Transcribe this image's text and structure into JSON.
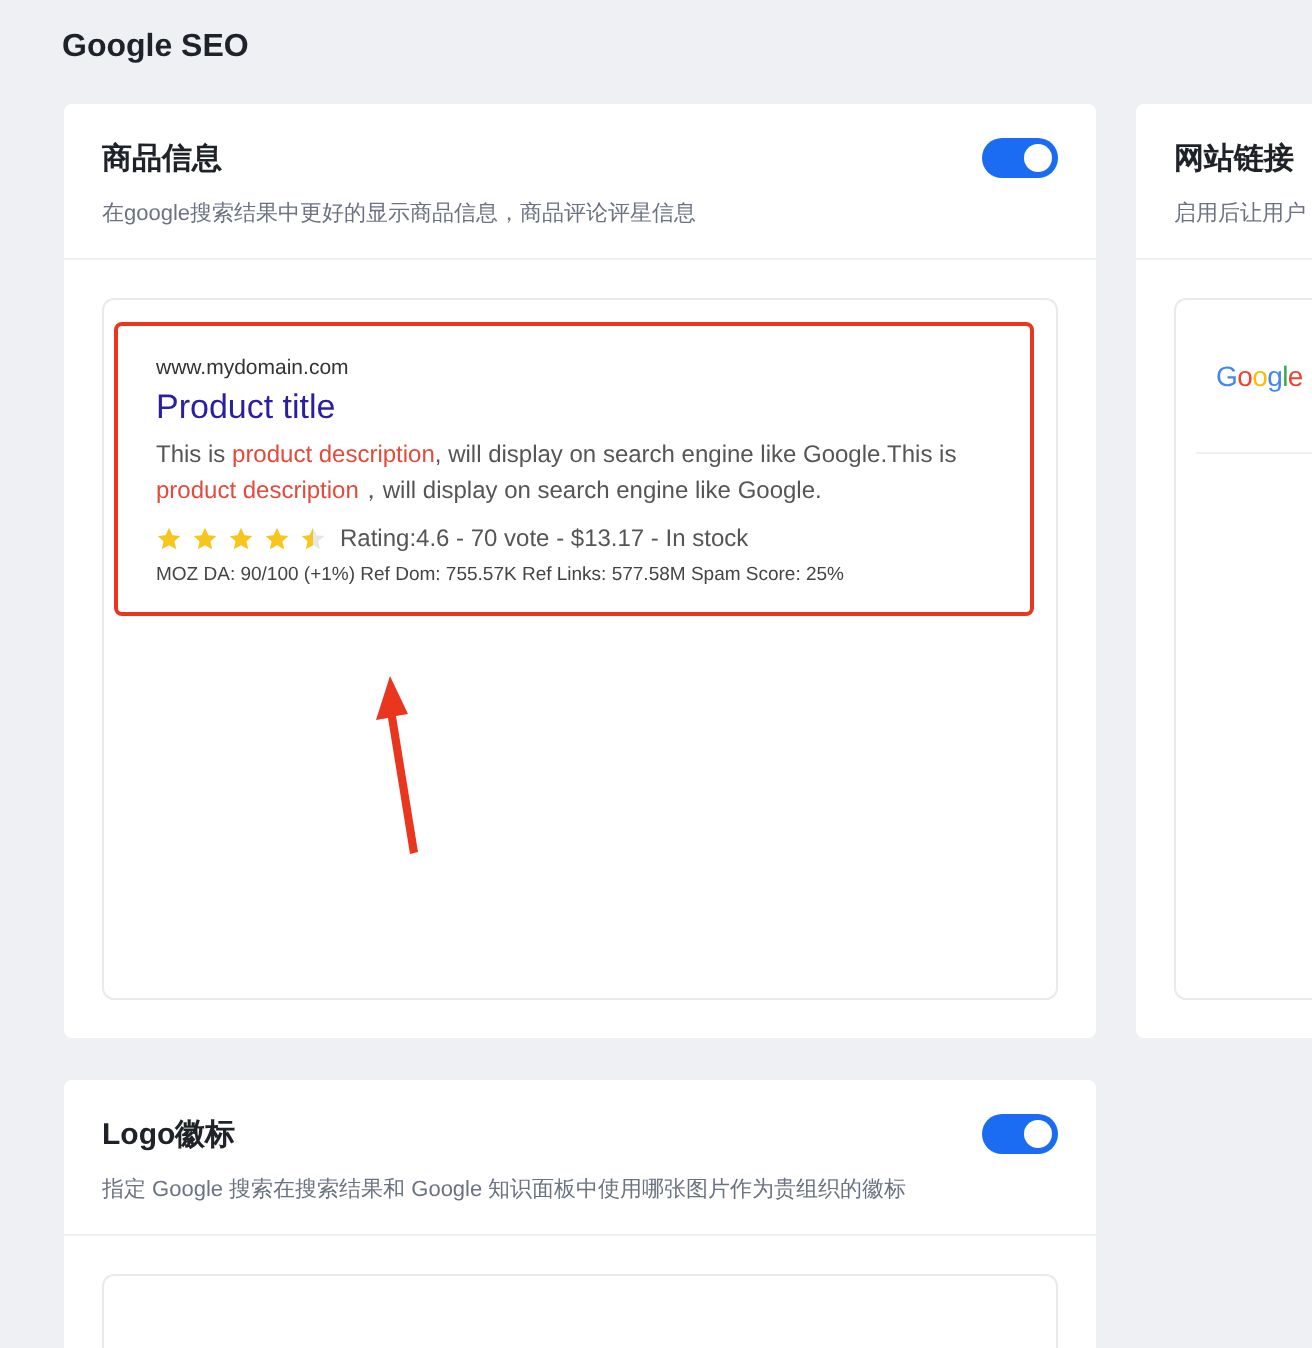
{
  "page_title": "Google SEO",
  "cards": [
    {
      "kind": "product_preview",
      "title": "商品信息",
      "description": "在google搜索结果中更好的显示商品信息，商品评论评星信息",
      "enabled": true,
      "preview": {
        "url": "www.mydomain.com",
        "title": "Product title",
        "snippet": [
          {
            "text": "This is ",
            "highlight": false
          },
          {
            "text": "product description",
            "highlight": true
          },
          {
            "text": ", will display on search engine like Google.This is ",
            "highlight": false
          },
          {
            "text": "product description",
            "highlight": true
          },
          {
            "text": "，will display on search engine like Google.",
            "highlight": false
          }
        ],
        "stars": 4.5,
        "rating": "Rating:4.6 - 70 vote - $13.17 - In stock",
        "metrics": "MOZ DA: 90/100 (+1%) Ref Dom: 755.57K Ref Links: 577.58M Spam Score: 25%"
      }
    },
    {
      "kind": "sitelinks",
      "title": "网站链接",
      "description": "启用后让用户",
      "logo": "Google"
    },
    {
      "kind": "logo",
      "title": "Logo徽标",
      "description": "指定 Google 搜索在搜索结果和 Google 知识面板中使用哪张图片作为贵组织的徽标",
      "enabled": true
    }
  ]
}
